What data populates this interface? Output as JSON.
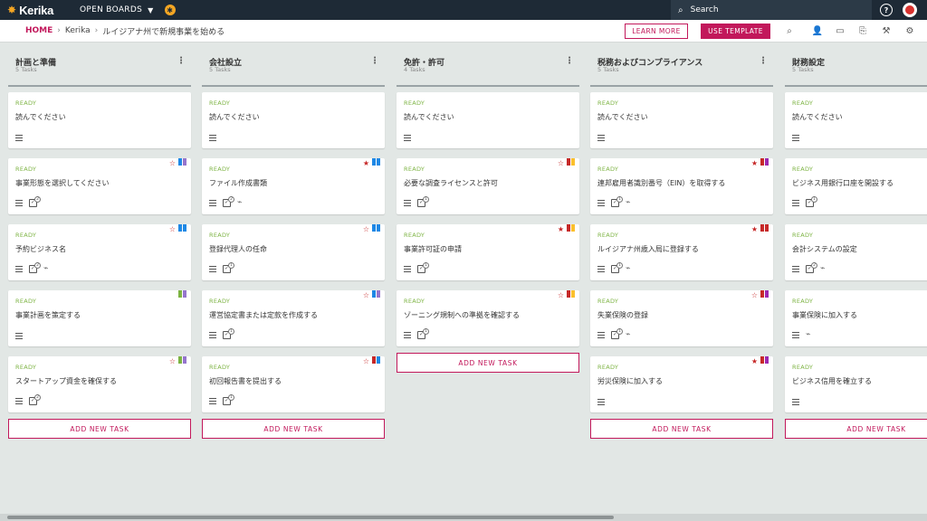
{
  "topbar": {
    "logo": "Kerika",
    "open_boards": "OPEN BOARDS",
    "search_placeholder": "Search"
  },
  "subbar": {
    "home": "HOME",
    "crumb_2": "Kerika",
    "crumb_3": "ルイジアナ州で新規事業を始める",
    "learn_more": "LEARN MORE",
    "use_template": "USE TEMPLATE"
  },
  "colors": {
    "accent": "#c2185b",
    "topbar": "#1e2a36",
    "status": "#7cb342",
    "flag_blue": "#1e88e5",
    "flag_purple": "#9575cd",
    "flag_red": "#c62828",
    "flag_yellow": "#fbc02d",
    "flag_green": "#7cb342"
  },
  "add_task_label": "ADD NEW TASK",
  "columns": [
    {
      "title": "計画と準備",
      "count": "5 Tasks",
      "cards": [
        {
          "status": "READY",
          "title": "読んでください",
          "flags": [],
          "star": "",
          "check": false,
          "clip": false
        },
        {
          "status": "READY",
          "title": "事業形態を選択してください",
          "flags": [
            "#1e88e5",
            "#9575cd"
          ],
          "star": "☆",
          "check": true,
          "badge": "2",
          "clip": false
        },
        {
          "status": "READY",
          "title": "予約ビジネス名",
          "flags": [
            "#1e88e5",
            "#1e88e5"
          ],
          "star": "☆",
          "check": true,
          "badge": "2",
          "clip": true
        },
        {
          "status": "READY",
          "title": "事業計画を策定する",
          "flags": [
            "#7cb342",
            "#9575cd"
          ],
          "star": "",
          "check": false,
          "clip": false
        },
        {
          "status": "READY",
          "title": "スタートアップ資金を確保する",
          "flags": [
            "#7cb342",
            "#9575cd"
          ],
          "star": "☆",
          "check": true,
          "badge": "2",
          "clip": false
        }
      ]
    },
    {
      "title": "会社設立",
      "count": "5 Tasks",
      "cards": [
        {
          "status": "READY",
          "title": "読んでください",
          "flags": [],
          "star": "",
          "check": false,
          "clip": false
        },
        {
          "status": "READY",
          "title": "ファイル作成書類",
          "flags": [
            "#1e88e5",
            "#1e88e5"
          ],
          "star": "★",
          "check": true,
          "badge": "2",
          "clip": true
        },
        {
          "status": "READY",
          "title": "登録代理人の任命",
          "flags": [
            "#1e88e5",
            "#1e88e5"
          ],
          "star": "☆",
          "check": true,
          "badge": "1",
          "clip": false
        },
        {
          "status": "READY",
          "title": "運営協定書または定款を作成する",
          "flags": [
            "#1e88e5",
            "#9575cd"
          ],
          "star": "☆",
          "check": true,
          "badge": "1",
          "clip": false
        },
        {
          "status": "READY",
          "title": "初回報告書を提出する",
          "flags": [
            "#c62828",
            "#1e88e5"
          ],
          "star": "☆",
          "check": true,
          "badge": "1",
          "clip": false
        }
      ]
    },
    {
      "title": "免許・許可",
      "count": "4 Tasks",
      "cards": [
        {
          "status": "READY",
          "title": "読んでください",
          "flags": [],
          "star": "",
          "check": false,
          "clip": false
        },
        {
          "status": "READY",
          "title": "必要な調査ライセンスと許可",
          "flags": [
            "#c62828",
            "#fbc02d"
          ],
          "star": "☆",
          "check": true,
          "badge": "1",
          "clip": false
        },
        {
          "status": "READY",
          "title": "事業許可証の申請",
          "flags": [
            "#c62828",
            "#fbc02d"
          ],
          "star": "★",
          "check": true,
          "badge": "1",
          "clip": false
        },
        {
          "status": "READY",
          "title": "ゾーニング規制への準拠を確認する",
          "flags": [
            "#c62828",
            "#fbc02d"
          ],
          "star": "☆",
          "check": true,
          "badge": "1",
          "clip": false
        }
      ]
    },
    {
      "title": "税務およびコンプライアンス",
      "count": "5 Tasks",
      "cards": [
        {
          "status": "READY",
          "title": "読んでください",
          "flags": [],
          "star": "",
          "check": false,
          "clip": false
        },
        {
          "status": "READY",
          "title": "連邦雇用者識別番号（EIN）を取得する",
          "flags": [
            "#c62828",
            "#9c27b0"
          ],
          "star": "★",
          "check": true,
          "badge": "1",
          "clip": true
        },
        {
          "status": "READY",
          "title": "ルイジアナ州歳入局に登録する",
          "flags": [
            "#c62828",
            "#c62828"
          ],
          "star": "★",
          "check": true,
          "badge": "1",
          "clip": true
        },
        {
          "status": "READY",
          "title": "失業保険の登録",
          "flags": [
            "#c62828",
            "#9c27b0"
          ],
          "star": "☆",
          "check": true,
          "badge": "1",
          "clip": true
        },
        {
          "status": "READY",
          "title": "労災保険に加入する",
          "flags": [
            "#c62828",
            "#9c27b0"
          ],
          "star": "★",
          "check": false,
          "clip": false
        }
      ]
    },
    {
      "title": "財務設定",
      "count": "5 Tasks",
      "cards": [
        {
          "status": "READY",
          "title": "読んでください",
          "flags": [],
          "star": "",
          "check": false,
          "clip": false
        },
        {
          "status": "READY",
          "title": "ビジネス用銀行口座を開設する",
          "flags": [],
          "star": "",
          "check": true,
          "badge": "1",
          "clip": false
        },
        {
          "status": "READY",
          "title": "会計システムの設定",
          "flags": [],
          "star": "",
          "check": true,
          "badge": "2",
          "clip": true
        },
        {
          "status": "READY",
          "title": "事業保険に加入する",
          "flags": [],
          "star": "",
          "check": false,
          "clip": true
        },
        {
          "status": "READY",
          "title": "ビジネス信用を確立する",
          "flags": [],
          "star": "",
          "check": false,
          "clip": false
        }
      ]
    }
  ]
}
